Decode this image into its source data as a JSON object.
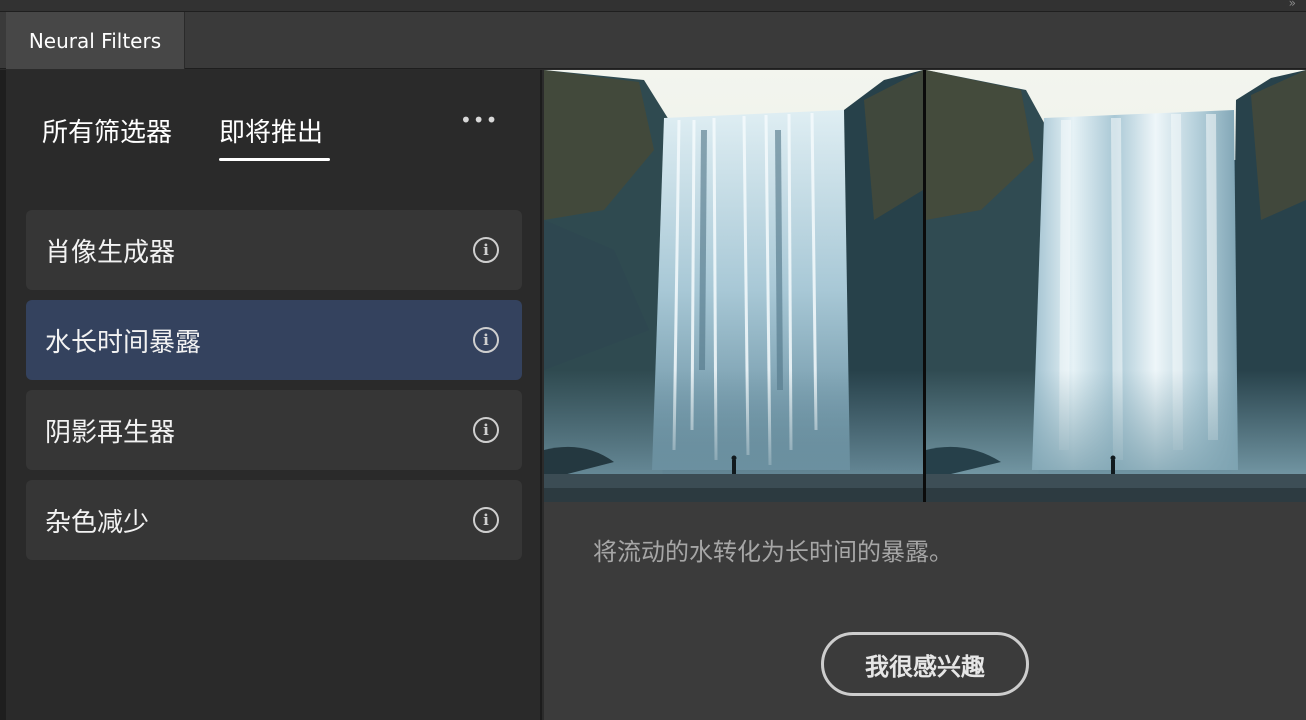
{
  "panel": {
    "tab_title": "Neural Filters"
  },
  "filter_tabs": {
    "all": "所有筛选器",
    "coming_soon": "即将推出"
  },
  "icons": {
    "more": "more-horizontal-icon",
    "info": "info-icon",
    "collapse": "double-chevron-icon"
  },
  "filters": [
    {
      "label": "肖像生成器",
      "selected": false
    },
    {
      "label": "水长时间暴露",
      "selected": true
    },
    {
      "label": "阴影再生器",
      "selected": false
    },
    {
      "label": "杂色减少",
      "selected": false
    }
  ],
  "preview": {
    "description": "将流动的水转化为长时间的暴露。",
    "button_label": "我很感兴趣"
  },
  "colors": {
    "selected_item": "#34425e",
    "item_bg": "#363636",
    "panel_bg": "#2a2a2a",
    "preview_bg": "#3b3b3b"
  }
}
